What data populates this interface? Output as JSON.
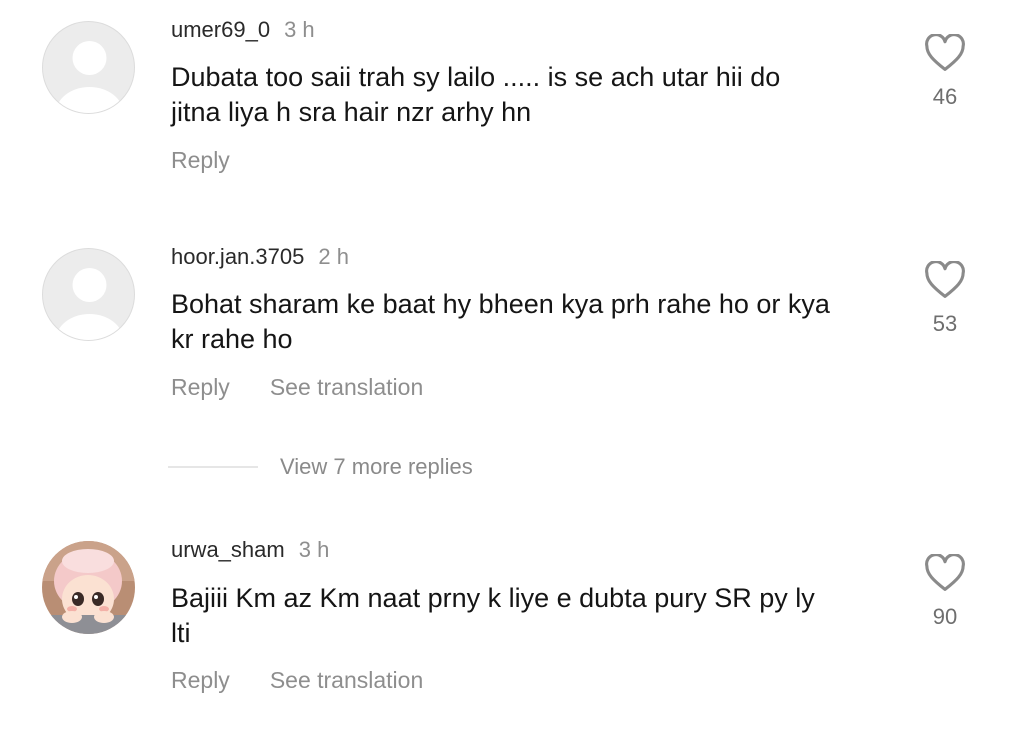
{
  "comments": [
    {
      "username": "umer69_0",
      "time": "3 h",
      "lines": [
        "Dubata too saii trah sy lailo ..... is se ach utar hii do",
        "jitna liya h sra hair nzr arhy hn"
      ],
      "reply_label": "Reply",
      "likes": "46",
      "avatar": "default-avatar"
    },
    {
      "username": "hoor.jan.3705",
      "time": "2 h",
      "lines": [
        "Bohat sharam ke baat hy bheen kya prh rahe ho or kya",
        "kr rahe ho"
      ],
      "reply_label": "Reply",
      "translate_label": "See translation",
      "likes": "53",
      "avatar": "default-avatar"
    },
    {
      "username": "urwa_sham",
      "time": "3 h",
      "lines": [
        "Bajiii Km az Km naat prny k liye e dubta pury SR py ly",
        "lti"
      ],
      "reply_label": "Reply",
      "translate_label": "See translation",
      "likes": "90",
      "avatar": "cartoon-girl-avatar"
    }
  ],
  "view_more_replies": "View 7 more replies",
  "colors": {
    "text": "#151515",
    "muted": "#8e8e8e",
    "heart": "#8a8a8a"
  },
  "icons": [
    "heart-outline-icon",
    "default-avatar",
    "cartoon-girl-avatar"
  ]
}
